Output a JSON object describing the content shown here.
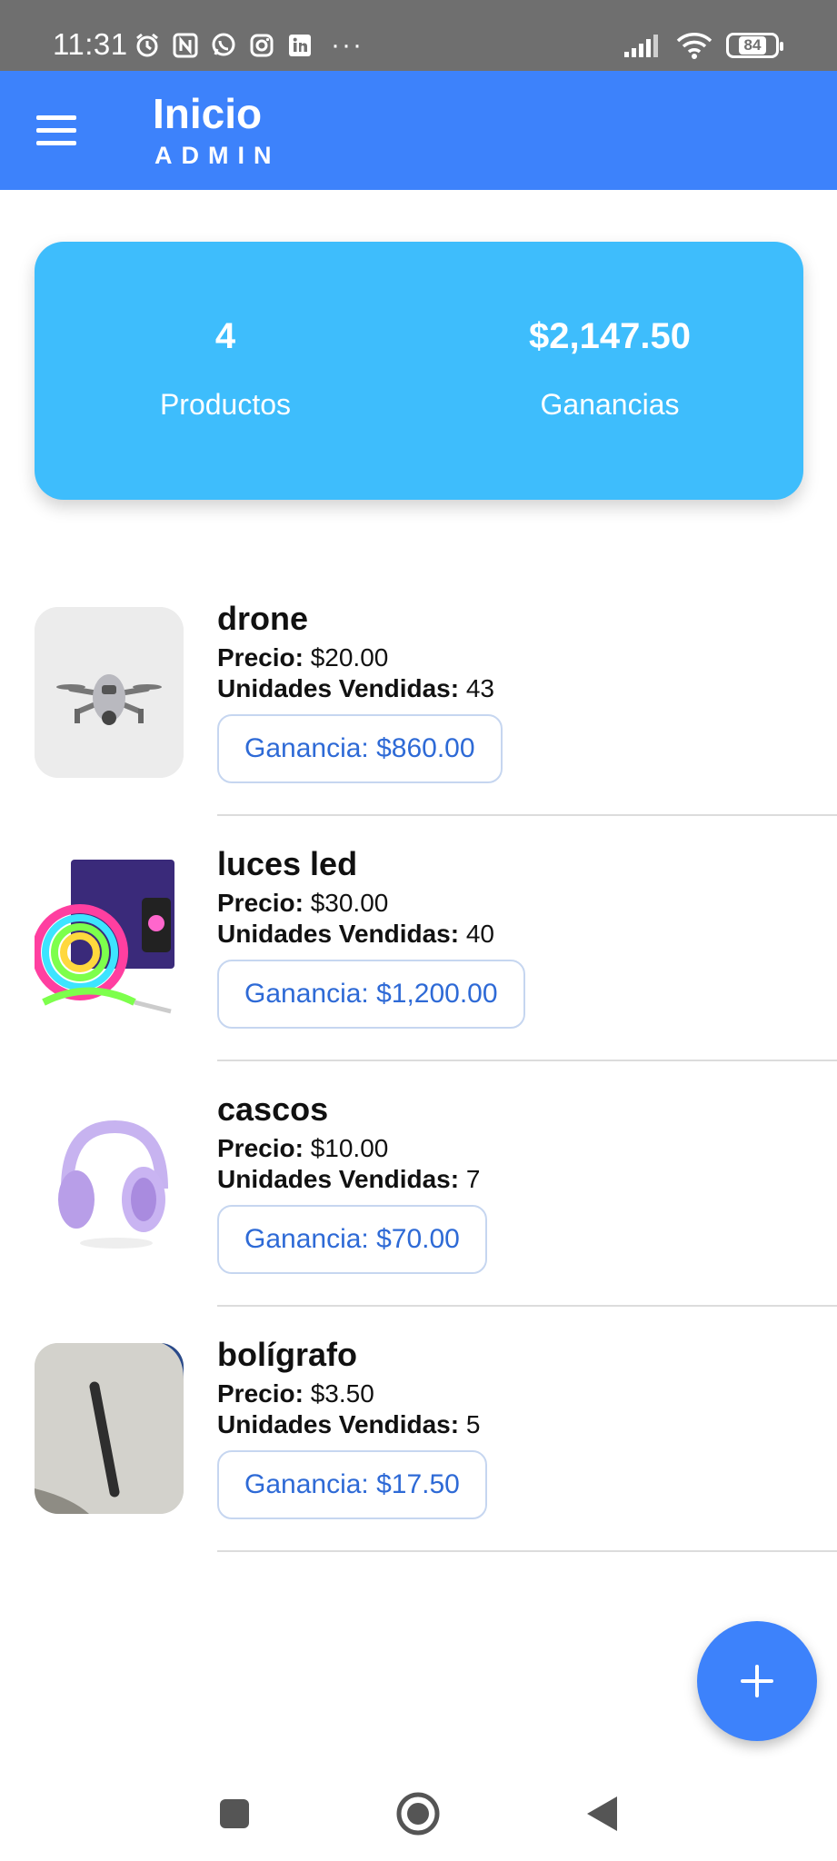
{
  "status_bar": {
    "time": "11:31",
    "battery": "84",
    "icons": [
      "alarm-icon",
      "nfc-icon",
      "whatsapp-icon",
      "instagram-icon",
      "linkedin-icon",
      "more-dots-icon",
      "signal-icon",
      "wifi-icon",
      "battery-icon"
    ]
  },
  "app_bar": {
    "title": "Inicio",
    "subtitle": "ADMIN",
    "menu_icon": "hamburger-menu-icon"
  },
  "summary": {
    "products_count": "4",
    "products_label": "Productos",
    "earnings_value": "$2,147.50",
    "earnings_label": "Ganancias"
  },
  "labels": {
    "price": "Precio:",
    "units": "Unidades Vendidas:"
  },
  "products": [
    {
      "name": "drone",
      "price": "$20.00",
      "units": "43",
      "gain": "Ganancia: $860.00",
      "image": "drone-image"
    },
    {
      "name": "luces led",
      "price": "$30.00",
      "units": "40",
      "gain": "Ganancia: $1,200.00",
      "image": "led-lights-image"
    },
    {
      "name": "cascos",
      "price": "$10.00",
      "units": "7",
      "gain": "Ganancia: $70.00",
      "image": "headphones-image"
    },
    {
      "name": "bolígrafo",
      "price": "$3.50",
      "units": "5",
      "gain": "Ganancia: $17.50",
      "image": "pen-image"
    }
  ],
  "fab": {
    "icon": "plus-icon"
  },
  "colors": {
    "status_bar": "#6f6f6f",
    "app_bar": "#3d82fb",
    "summary_card": "#3ebdfc",
    "chip_text": "#2e6ad6",
    "chip_border": "#c6d6f0"
  }
}
